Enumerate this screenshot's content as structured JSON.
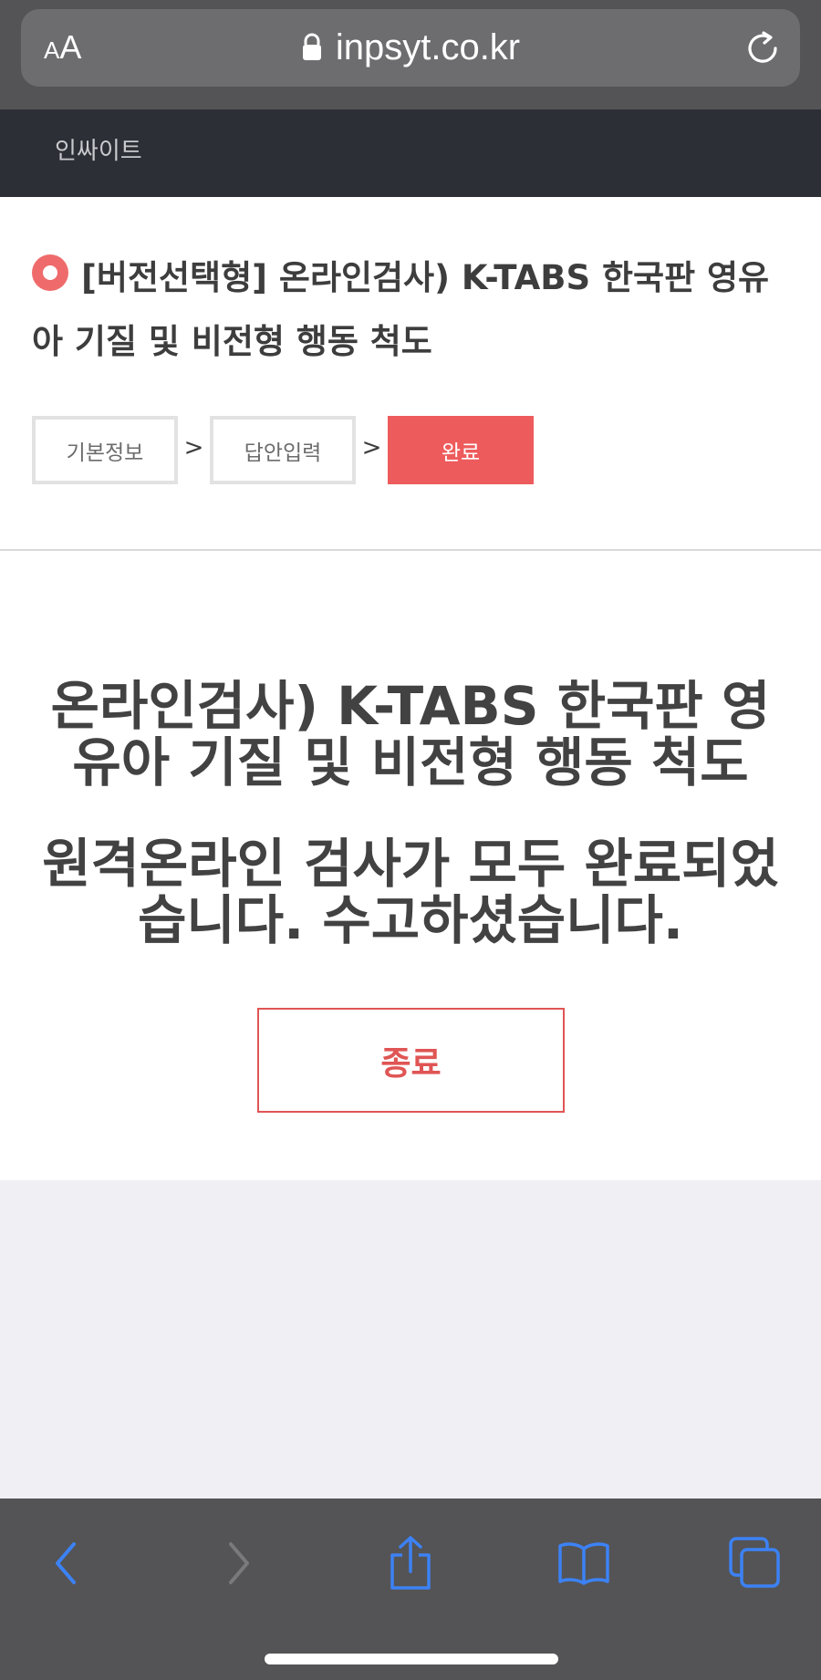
{
  "browser": {
    "text_size_label_small": "A",
    "text_size_label_large": "A",
    "url": "inpsyt.co.kr"
  },
  "site": {
    "title": "인싸이트"
  },
  "test": {
    "title": "[버전선택형] 온라인검사) K-TABS 한국판 영유아 기질 및 비전형 행동 척도"
  },
  "steps": [
    {
      "label": "기본정보"
    },
    {
      "label": "답안입력"
    },
    {
      "label": "완료"
    }
  ],
  "step_separator": ">",
  "completion": {
    "heading": "온라인검사) K-TABS 한국판 영유아 기질 및 비전형 행동 척도",
    "message": "원격온라인 검사가 모두 완료되었습니다. 수고하셨습니다.",
    "exit_label": "종료"
  },
  "colors": {
    "accent": "#ee5b5c",
    "header_bg": "#2d2f37",
    "browser_chrome": "#545456",
    "toolbar_icon": "#3c82f6"
  },
  "icons": {
    "lock": "lock-icon",
    "reload": "reload-icon",
    "back": "chevron-left-icon",
    "forward": "chevron-right-icon",
    "share": "share-icon",
    "bookmarks": "book-icon",
    "tabs": "tabs-icon"
  }
}
